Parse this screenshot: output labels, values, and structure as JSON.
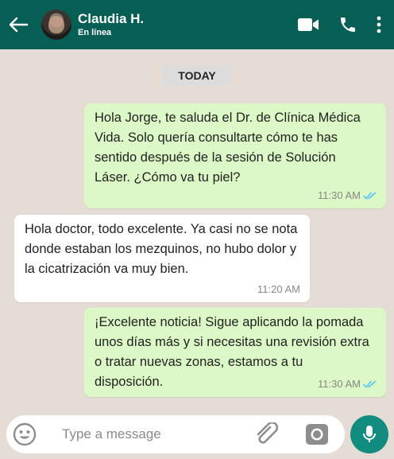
{
  "header": {
    "contact_name": "Claudia H.",
    "status": "En línea",
    "icons": [
      "back-arrow-icon",
      "video-call-icon",
      "phone-icon",
      "more-vertical-icon"
    ],
    "background_color": "#075e54"
  },
  "chat": {
    "day_label": "TODAY",
    "messages": [
      {
        "direction": "outgoing",
        "text": "Hola Jorge, te saluda el Dr. de Clínica Médica Vida. Solo quería consultarte cómo te has sentido después de la sesión de Solución Láser. ¿Cómo va tu piel?",
        "time": "11:30 AM",
        "read": true
      },
      {
        "direction": "incoming",
        "text": "Hola doctor, todo excelente. Ya casi no se nota donde estaban los mezquinos, no hubo dolor y la cicatrización va muy bien.",
        "time": "11:20 AM"
      },
      {
        "direction": "outgoing",
        "text": "¡Excelente noticia! Sigue aplicando la pomada unos días más y si necesitas una revisión extra o tratar nuevas zonas, estamos a tu disposición.",
        "time": "11:30 AM",
        "read": true
      }
    ],
    "colors": {
      "outgoing_bubble": "#dcf8c6",
      "incoming_bubble": "#ffffff",
      "read_ticks": "#4fc3f7"
    }
  },
  "composer": {
    "placeholder": "Type a message",
    "value": "",
    "icons": [
      "emoji-icon",
      "attach-icon",
      "camera-icon",
      "mic-icon"
    ],
    "mic_button_color": "#128c7e"
  }
}
